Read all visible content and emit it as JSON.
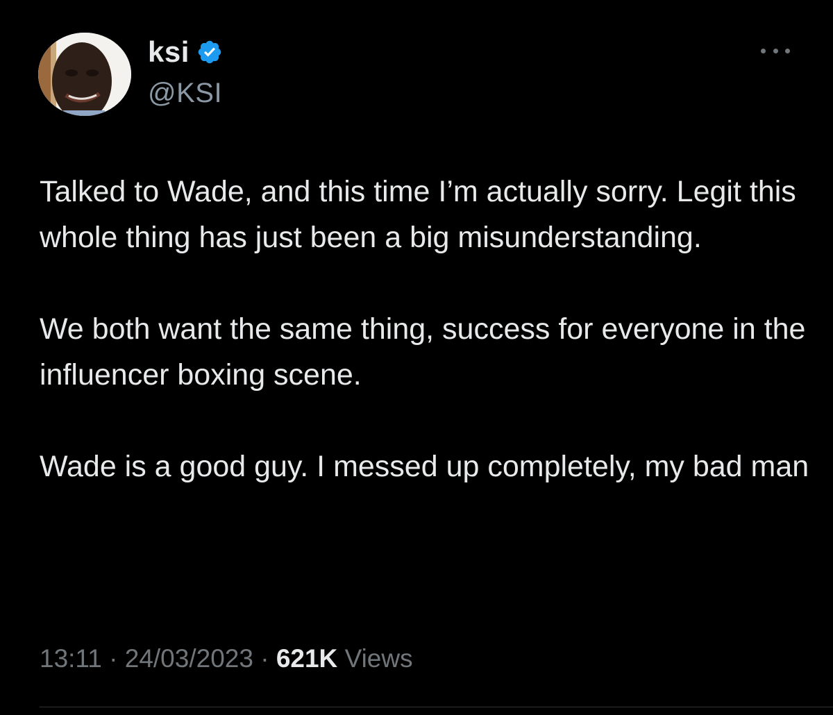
{
  "tweet": {
    "author": {
      "display_name": "ksi",
      "handle": "@KSI",
      "verified": true,
      "avatar_icon": "profile-photo"
    },
    "more_icon": "ellipsis-icon",
    "paragraphs": [
      "Talked to Wade, and this time I’m actually sorry. Legit this whole thing has just been a big misunderstanding.",
      "We both want the same thing, success for everyone in the influencer boxing scene.",
      "Wade is a good guy. I messed up completely, my bad man"
    ],
    "meta": {
      "time": "13:11",
      "separator": " · ",
      "date": "24/03/2023",
      "views_count": "621K",
      "views_label": "Views"
    }
  },
  "colors": {
    "background": "#000000",
    "text": "#e7e9ea",
    "secondary_text": "#71767b",
    "verified_badge": "#1d9bf0"
  }
}
